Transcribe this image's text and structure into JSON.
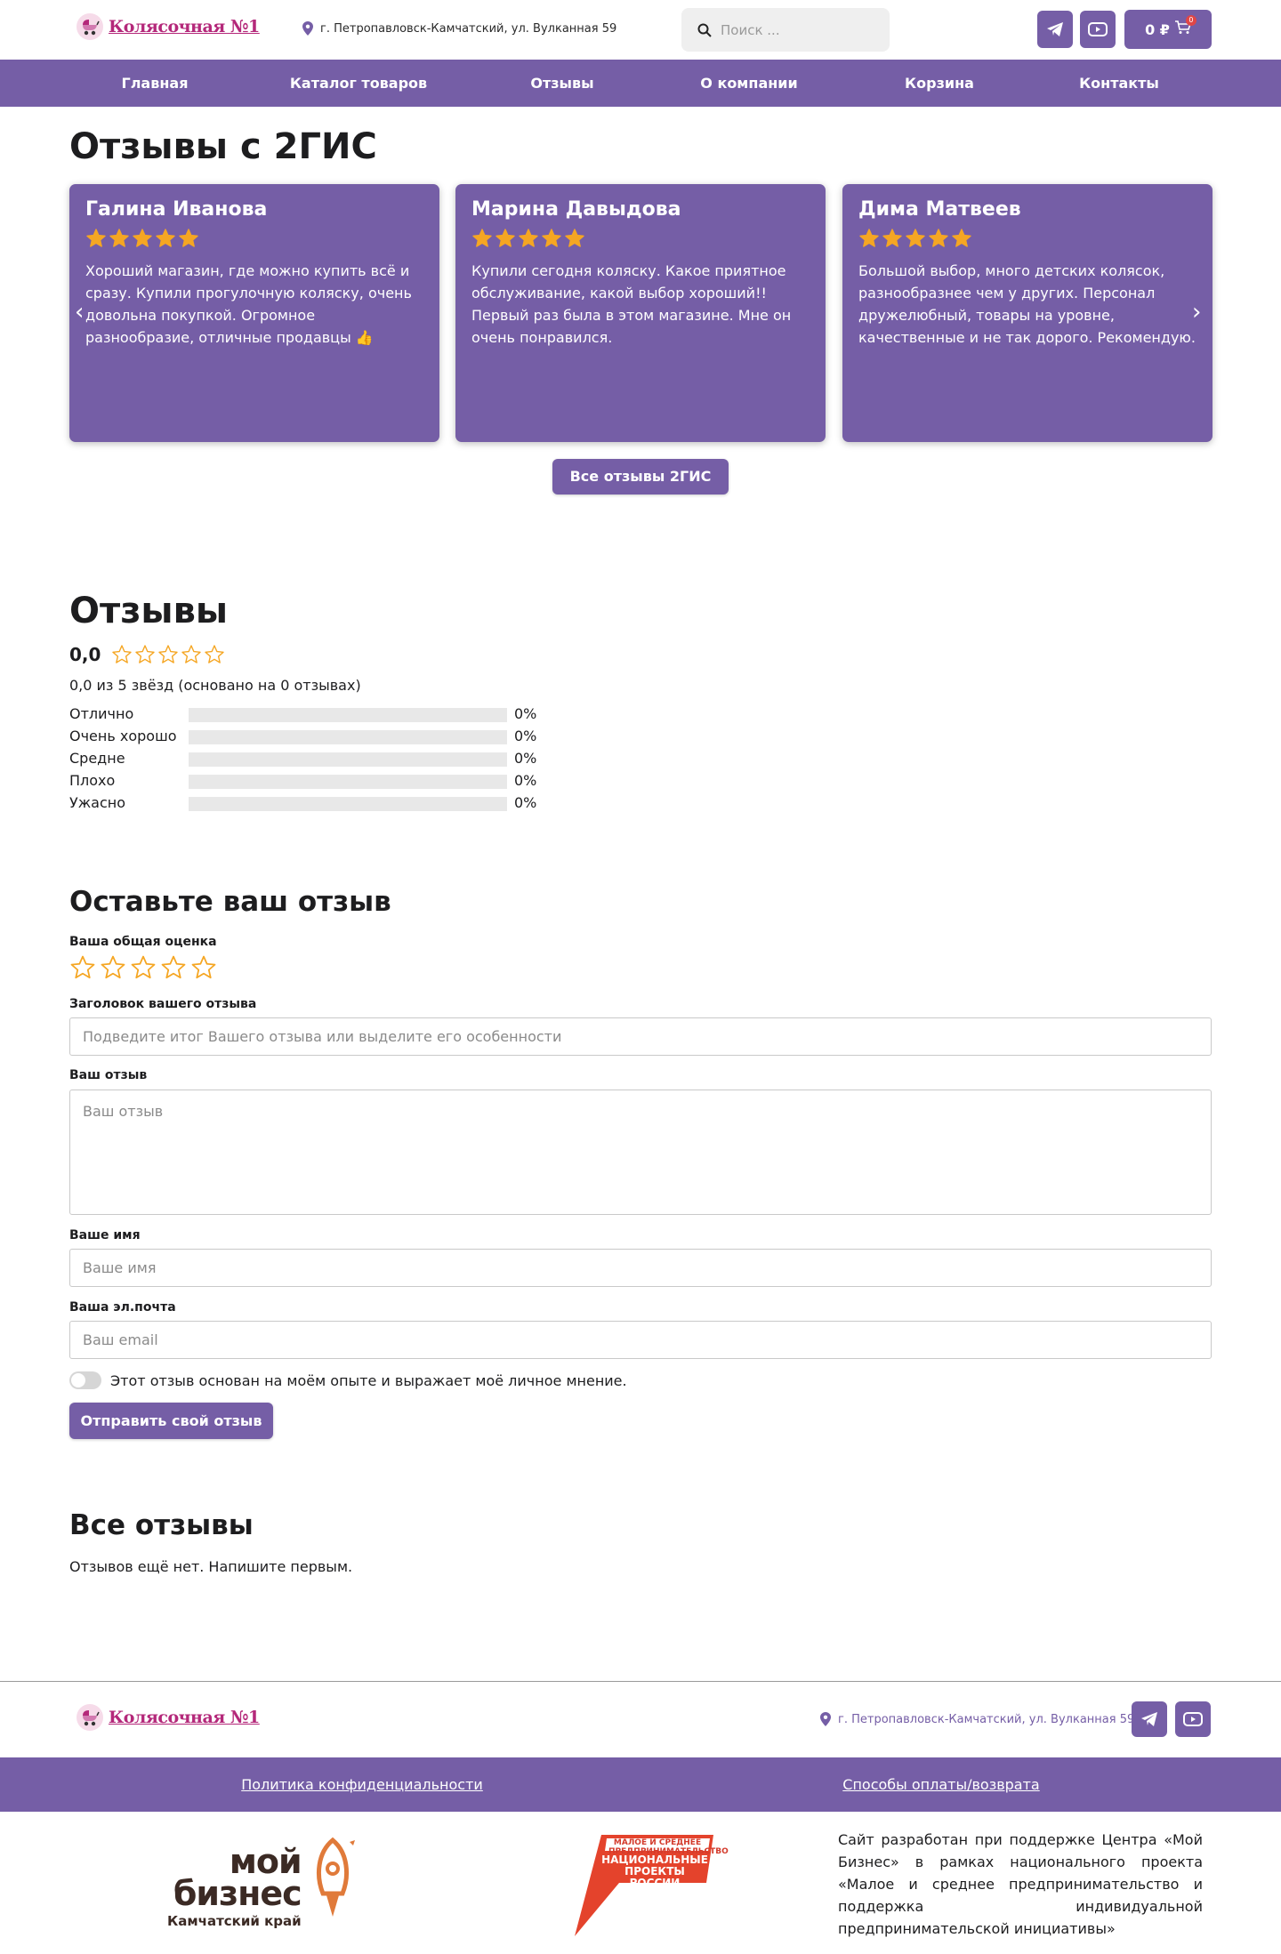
{
  "header": {
    "logo_text": "Колясочная №1",
    "address": "г. Петропавловск-Камчатский, ул. Вулканная 59",
    "search_placeholder": "Поиск ...",
    "cart_total": "0 ₽",
    "cart_count": "0"
  },
  "nav": {
    "items": [
      "Главная",
      "Каталог товаров",
      "Отзывы",
      "О компании",
      "Корзина",
      "Контакты"
    ]
  },
  "gis_section": {
    "title": "Отзывы с 2ГИС",
    "all_button": "Все отзывы 2ГИС",
    "reviews": [
      {
        "name": "Галина Иванова",
        "stars": 5,
        "text": "Хороший магазин, где можно купить всё и сразу. Купили прогулочную коляску, очень довольна покупкой. Огромное разнообразие, отличные продавцы 👍"
      },
      {
        "name": "Марина Давыдова",
        "stars": 5,
        "text": "Купили сегодня коляску. Какое приятное обслуживание, какой выбор хороший!! Первый раз была в этом магазине. Мне он очень понравился."
      },
      {
        "name": "Дима Матвеев",
        "stars": 5,
        "text": "Большой выбор, много детских колясок, разнообразнее чем у других. Персонал дружелюбный, товары на уровне, качественные и не так дорого. Рекомендую."
      }
    ]
  },
  "ratings": {
    "title": "Отзывы",
    "average": "0,0",
    "summary": "0,0 из 5 звёзд (основано на 0 отзывах)",
    "rows": [
      {
        "label": "Отлично",
        "percent": "0%",
        "fraction": 0
      },
      {
        "label": "Очень хорошо",
        "percent": "0%",
        "fraction": 0
      },
      {
        "label": "Средне",
        "percent": "0%",
        "fraction": 0
      },
      {
        "label": "Плохо",
        "percent": "0%",
        "fraction": 0
      },
      {
        "label": "Ужасно",
        "percent": "0%",
        "fraction": 0
      }
    ]
  },
  "form": {
    "title": "Оставьте ваш отзыв",
    "rating_label": "Ваша общая оценка",
    "headline_label": "Заголовок вашего отзыва",
    "headline_placeholder": "Подведите итог Вашего отзыва или выделите его особенности",
    "review_label": "Ваш отзыв",
    "review_placeholder": "Ваш отзыв",
    "name_label": "Ваше имя",
    "name_placeholder": "Ваше имя",
    "email_label": "Ваша эл.почта",
    "email_placeholder": "Ваш email",
    "consent_text": "Этот отзыв основан на моём опыте и выражает моё личное мнение.",
    "submit_label": "Отправить свой отзыв"
  },
  "all_reviews": {
    "title": "Все отзывы",
    "empty_text": "Отзывов ещё нет. Напишите первым."
  },
  "footer": {
    "logo_text": "Колясочная №1",
    "address": "г. Петропавловск-Камчатский, ул. Вулканная 59",
    "links": [
      "Политика конфиденциальности",
      "Способы оплаты/возврата"
    ],
    "moy_biznes": {
      "line1": "мой",
      "line2": "бизнес",
      "region": "Камчатский край"
    },
    "natsproekty": {
      "small": "МАЛОЕ И СРЕДНЕЕ ПРЕДПРИНИМАТЕЛЬСТВО",
      "big": "НАЦИОНАЛЬНЫЕ ПРОЕКТЫ РОССИИ"
    },
    "support_text": "Сайт разработан при поддержке Центра «Мой Бизнес» в рамках национального проекта «Малое и среднее предпринимательство и поддержка индивидуальной предпринимательской инициативы»"
  },
  "colors": {
    "accent": "#755ea6",
    "star": "#f5a623",
    "logo_pink": "#b4287a"
  }
}
